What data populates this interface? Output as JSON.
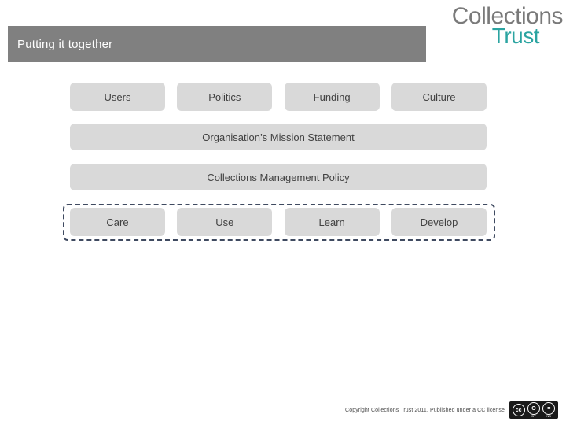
{
  "logo": {
    "line1": "Collections",
    "line2": "Trust",
    "color_line1": "#7a7a7a",
    "color_line2": "#2ba4a1"
  },
  "title_bar": {
    "text": "Putting it together",
    "background": "#808080",
    "text_color": "#ffffff"
  },
  "diagram": {
    "box_fill": "#d9d9d9",
    "box_text_color": "#414141",
    "group_outline_color": "#3f4a60",
    "rows": {
      "drivers": [
        {
          "label": "Users"
        },
        {
          "label": "Politics"
        },
        {
          "label": "Funding"
        },
        {
          "label": "Culture"
        }
      ],
      "mission": {
        "label": "Organisation’s Mission Statement"
      },
      "policy": {
        "label": "Collections Management Policy"
      },
      "activities": [
        {
          "label": "Care"
        },
        {
          "label": "Use"
        },
        {
          "label": "Learn"
        },
        {
          "label": "Develop"
        }
      ]
    }
  },
  "footer": {
    "copyright": "Copyright Collections Trust 2011. Published under a CC license",
    "cc_badge": {
      "cc": "cc",
      "by_symbol": "ʘ",
      "by_caption": "BY",
      "nd_symbol": "=",
      "nd_caption": "ND"
    }
  }
}
